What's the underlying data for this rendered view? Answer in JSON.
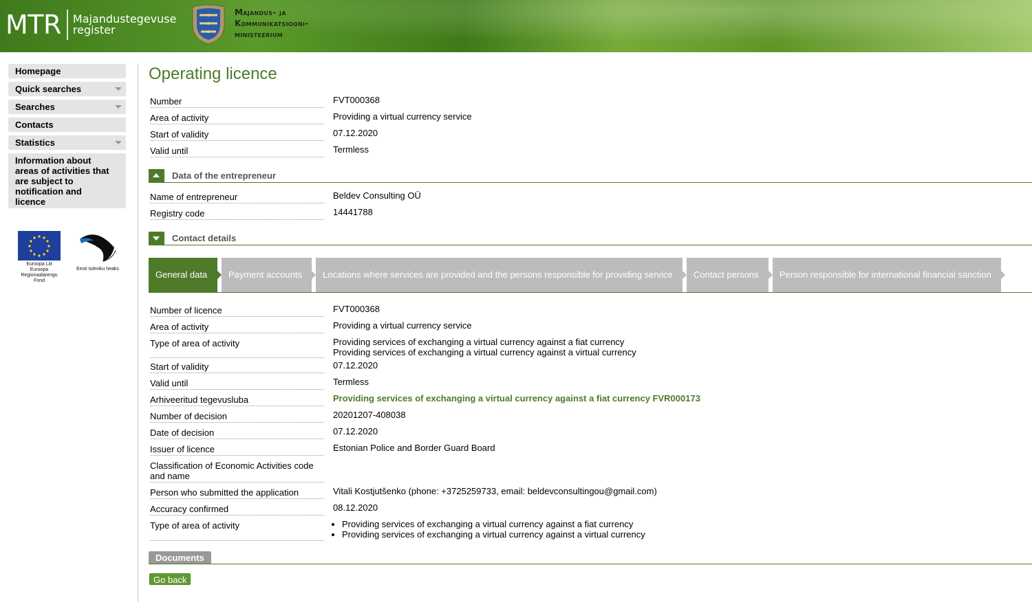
{
  "header": {
    "logo_main": "MTR",
    "logo_sub_line1": "Majandustegevuse",
    "logo_sub_line2": "register",
    "ministry_line1": "Majandus- ja",
    "ministry_line2": "Kommunikatsiooni-",
    "ministry_line3": "ministeerium",
    "crest_icon": "estonian-coat-of-arms"
  },
  "sidebar": {
    "items": [
      {
        "label": "Homepage",
        "has_dropdown": false
      },
      {
        "label": "Quick searches",
        "has_dropdown": true
      },
      {
        "label": "Searches",
        "has_dropdown": true
      },
      {
        "label": "Contacts",
        "has_dropdown": false
      },
      {
        "label": "Statistics",
        "has_dropdown": true
      },
      {
        "label": "Information about areas of activities that are subject to notification and licence",
        "has_dropdown": false
      }
    ],
    "eu_caption_line1": "Euroopa Liit",
    "eu_caption_line2": "Euroopa",
    "eu_caption_line3": "Regionaalarengu Fond",
    "est_caption": "Eesti tuleviku heaks"
  },
  "main": {
    "title": "Operating licence",
    "summary": [
      {
        "label": "Number",
        "value": "FVT000368"
      },
      {
        "label": "Area of activity",
        "value": "Providing a virtual currency service"
      },
      {
        "label": "Start of validity",
        "value": "07.12.2020"
      },
      {
        "label": "Valid until",
        "value": "Termless"
      }
    ],
    "entrepreneur_section_title": "Data of the entrepreneur",
    "entrepreneur": [
      {
        "label": "Name of entrepreneur",
        "value": "Beldev Consulting OÜ"
      },
      {
        "label": "Registry code",
        "value": "14441788"
      }
    ],
    "contact_section_title": "Contact details",
    "tabs": [
      {
        "label": "General data",
        "active": true
      },
      {
        "label": "Payment accounts",
        "active": false
      },
      {
        "label": "Locations where services are provided and the persons responsible for providing service",
        "active": false
      },
      {
        "label": "Contact persons",
        "active": false
      },
      {
        "label": "Person responsible for international financial sanction",
        "active": false
      }
    ],
    "general": {
      "number_of_licence_label": "Number of licence",
      "number_of_licence": "FVT000368",
      "area_label": "Area of activity",
      "area": "Providing a virtual currency service",
      "type_label": "Type of area of activity",
      "type_line1": "Providing services of exchanging a virtual currency against a fiat currency",
      "type_line2": "Providing services of exchanging a virtual currency against a virtual currency",
      "start_label": "Start of validity",
      "start": "07.12.2020",
      "valid_label": "Valid until",
      "valid": "Termless",
      "archived_label": "Arhiveeritud tegevusluba",
      "archived_link": "Providing services of exchanging a virtual currency against a fiat currency FVR000173",
      "decision_number_label": "Number of decision",
      "decision_number": "20201207-408038",
      "decision_date_label": "Date of decision",
      "decision_date": "07.12.2020",
      "issuer_label": "Issuer of licence",
      "issuer": "Estonian Police and Border Guard Board",
      "classification_label": "Classification of Economic Activities code and name",
      "classification": "",
      "submitter_label": "Person who submitted the application",
      "submitter": "Vitali Kostjutšenko (phone: +3725259733, email: beldevconsultingou@gmail.com)",
      "accuracy_label": "Accuracy confirmed",
      "accuracy": "08.12.2020",
      "type2_label": "Type of area of activity",
      "type2_items": [
        "Providing services of exchanging a virtual currency against a fiat currency",
        "Providing services of exchanging a virtual currency against a virtual currency"
      ]
    },
    "documents_label": "Documents",
    "go_back_label": "Go back"
  }
}
